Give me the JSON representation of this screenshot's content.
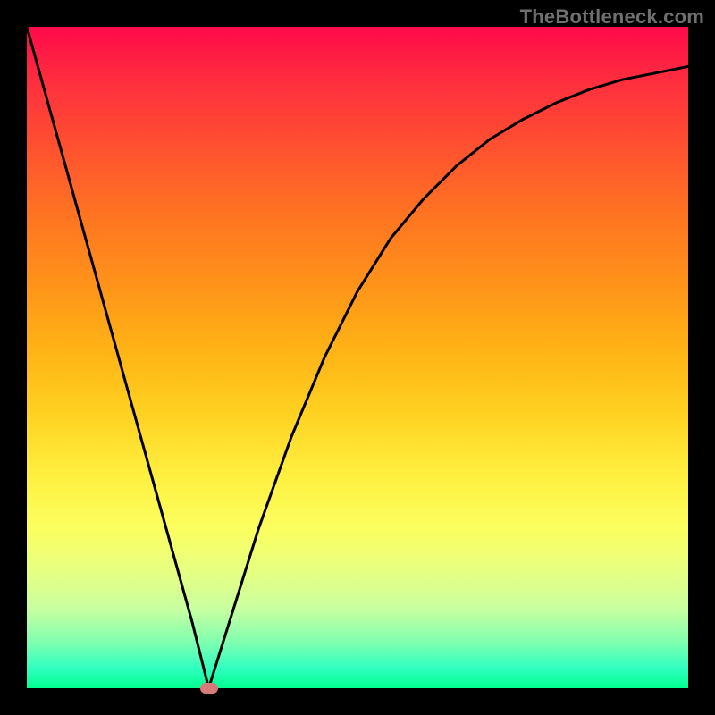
{
  "watermark": "TheBottleneck.com",
  "chart_data": {
    "type": "line",
    "title": "",
    "xlabel": "",
    "ylabel": "",
    "xlim": [
      0,
      100
    ],
    "ylim": [
      0,
      100
    ],
    "grid": false,
    "legend": false,
    "series": [
      {
        "name": "curve",
        "x": [
          0,
          5,
          10,
          15,
          20,
          25,
          27.5,
          30,
          35,
          40,
          45,
          50,
          55,
          60,
          65,
          70,
          75,
          80,
          85,
          90,
          95,
          100
        ],
        "y": [
          100,
          82,
          64,
          46,
          28,
          10,
          0,
          8,
          24,
          38,
          50,
          60,
          68,
          74,
          79,
          83,
          86,
          88.5,
          90.5,
          92,
          93,
          94
        ]
      }
    ],
    "marker": {
      "x": 27.5,
      "y": 0,
      "color": "#d87a7a"
    },
    "gradient_stops": [
      {
        "pos": 0,
        "color": "#ff0a4a"
      },
      {
        "pos": 50,
        "color": "#ffb015"
      },
      {
        "pos": 75,
        "color": "#fbff60"
      },
      {
        "pos": 100,
        "color": "#00ff90"
      }
    ]
  }
}
